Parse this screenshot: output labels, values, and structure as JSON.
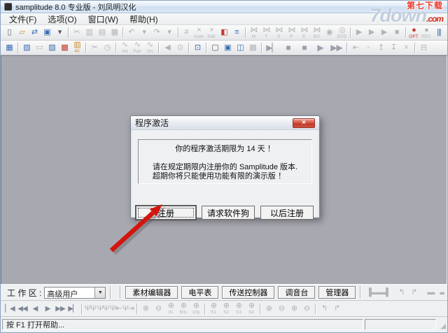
{
  "window": {
    "title": "samplitude 8.0 专业版 - 刘凤明汉化"
  },
  "watermark": {
    "line1": "第七下载",
    "brand": "7down",
    "tld": ".com"
  },
  "menu": {
    "items": [
      {
        "n": "menu-file",
        "label": "文件(F)"
      },
      {
        "n": "menu-options",
        "label": "选项(O)"
      },
      {
        "n": "menu-window",
        "label": "窗口(W)"
      },
      {
        "n": "menu-help",
        "label": "帮助(H)"
      }
    ]
  },
  "toolbar1": {
    "items": [
      {
        "n": "new-project-icon",
        "g": "▯",
        "c": "t",
        "i": "true"
      },
      {
        "n": "open-project-icon",
        "g": "▱",
        "c": "t org",
        "i": "true"
      },
      {
        "n": "import-audio-icon",
        "g": "⇄",
        "c": "t blue",
        "i": "true"
      },
      {
        "n": "save-icon",
        "g": "▣",
        "c": "t blue",
        "i": "true"
      },
      {
        "n": "save-menu-arrow-icon",
        "g": "▾",
        "c": "t",
        "i": "true"
      },
      {
        "n": "separator",
        "g": "",
        "c": "sep",
        "i": "false"
      },
      {
        "n": "cut-icon",
        "g": "✂",
        "c": "t dis",
        "i": "true"
      },
      {
        "n": "copy-icon",
        "g": "▥",
        "c": "t dis",
        "i": "true"
      },
      {
        "n": "paste-icon",
        "g": "▤",
        "c": "t dis",
        "i": "true"
      },
      {
        "n": "paste-special-icon",
        "g": "▦",
        "c": "t dis",
        "i": "true"
      },
      {
        "n": "separator",
        "g": "",
        "c": "sep",
        "i": "false"
      },
      {
        "n": "undo-icon",
        "g": "↶",
        "c": "t dis",
        "i": "true"
      },
      {
        "n": "undo-menu-arrow-icon",
        "g": "▾",
        "c": "t dis",
        "i": "true"
      },
      {
        "n": "redo-icon",
        "g": "↷",
        "c": "t dis",
        "i": "true"
      },
      {
        "n": "redo-menu-arrow-icon",
        "g": "▾",
        "c": "t dis",
        "i": "true"
      },
      {
        "n": "separator",
        "g": "",
        "c": "sep",
        "i": "false"
      },
      {
        "n": "snap-toggle-icon",
        "g": "#",
        "c": "t dis",
        "i": "true"
      },
      {
        "n": "auto-crossfade-icon",
        "g": "×",
        "l": "Auto",
        "c": "t dis",
        "i": "true"
      },
      {
        "n": "edit-crossfade-icon",
        "g": "×",
        "l": "Edit",
        "c": "t dis",
        "i": "true"
      },
      {
        "n": "object-editor-icon",
        "g": "◧",
        "c": "t red",
        "i": "true"
      },
      {
        "n": "track-editor-icon",
        "g": "≡",
        "c": "t blue",
        "i": "true"
      },
      {
        "n": "separator",
        "g": "",
        "c": "sep",
        "i": "false"
      },
      {
        "n": "crossfade-m-icon",
        "g": "⋈",
        "l": "M",
        "c": "t dis",
        "i": "true"
      },
      {
        "n": "crossfade-t-icon",
        "g": "⋈",
        "l": "T",
        "c": "t dis",
        "i": "true"
      },
      {
        "n": "crossfade-s-icon",
        "g": "⋈",
        "l": "S",
        "c": "t dis",
        "i": "true"
      },
      {
        "n": "crossfade-p-icon",
        "g": "⋈",
        "l": "P",
        "c": "t dis",
        "i": "true"
      },
      {
        "n": "crossfade-e-icon",
        "g": "⋈",
        "l": "E",
        "c": "t dis",
        "i": "true"
      },
      {
        "n": "crossfade-62-icon",
        "g": "⋈",
        "l": "6/2",
        "c": "t dis",
        "i": "true"
      },
      {
        "n": "cd-burn-icon",
        "g": "◉",
        "c": "t dis",
        "i": "true"
      },
      {
        "n": "dvd-export-icon",
        "g": "◎",
        "l": "DVD",
        "c": "t dis",
        "i": "true"
      },
      {
        "n": "separator",
        "g": "",
        "c": "sep",
        "i": "false"
      },
      {
        "n": "play-once-icon",
        "g": "▶",
        "c": "t dis",
        "i": "true"
      },
      {
        "n": "play-loop-icon",
        "g": "▶",
        "c": "t dis",
        "i": "true"
      },
      {
        "n": "play-range-icon",
        "g": "▶",
        "c": "t dis",
        "i": "true"
      },
      {
        "n": "stop-playback-icon",
        "g": "■",
        "c": "t dis",
        "i": "true"
      },
      {
        "n": "separator",
        "g": "",
        "c": "sep",
        "i": "false"
      },
      {
        "n": "record-options-icon",
        "g": "●",
        "l": "OPT",
        "c": "t red",
        "i": "true"
      },
      {
        "n": "record-icon",
        "g": "●",
        "l": "REC",
        "c": "t dis",
        "i": "true"
      },
      {
        "n": "mixer-window-icon",
        "g": "|||",
        "c": "t blue",
        "i": "true"
      }
    ]
  },
  "toolbar2": {
    "items": [
      {
        "n": "mouse-mode-universal-icon",
        "g": "▦",
        "c": "t blue",
        "i": "true"
      },
      {
        "n": "separator",
        "g": "",
        "c": "sep",
        "i": "false"
      },
      {
        "n": "mouse-mode-range-icon",
        "g": "▧",
        "c": "t blue",
        "i": "true"
      },
      {
        "n": "mouse-mode-object-icon",
        "g": "▭",
        "c": "t dis",
        "i": "true"
      },
      {
        "n": "mouse-mode-curve-icon",
        "g": "▨",
        "c": "t blue",
        "i": "true"
      },
      {
        "n": "mouse-mode-cut-icon",
        "g": "▩",
        "c": "t red",
        "i": "true"
      },
      {
        "n": "mouse-mode-zoom-icon",
        "g": "▥",
        "l": "40",
        "c": "t org",
        "i": "true"
      },
      {
        "n": "separator",
        "g": "",
        "c": "sep",
        "i": "false"
      },
      {
        "n": "cut-object-icon",
        "g": "✂",
        "c": "t dis",
        "i": "true"
      },
      {
        "n": "time-display-icon",
        "g": "◷",
        "c": "t dis",
        "i": "true"
      },
      {
        "n": "separator",
        "g": "",
        "c": "sep",
        "i": "false"
      },
      {
        "n": "volume-curve-icon",
        "g": "∿",
        "l": "Vol",
        "c": "t dis",
        "i": "true"
      },
      {
        "n": "pan-curve-icon",
        "g": "∿",
        "l": "Pan",
        "c": "t dis",
        "i": "true"
      },
      {
        "n": "wave-curve-icon",
        "g": "∿",
        "l": "Vn",
        "c": "t dis",
        "i": "true"
      },
      {
        "n": "separator",
        "g": "",
        "c": "sep",
        "i": "false"
      },
      {
        "n": "speaker-icon",
        "g": "◀",
        "c": "t dis",
        "i": "true"
      },
      {
        "n": "scrub-magnifier-icon",
        "g": "⊙",
        "c": "t dis",
        "i": "true"
      },
      {
        "n": "separator",
        "g": "",
        "c": "sep",
        "i": "false"
      },
      {
        "n": "monitor-lock-icon",
        "g": "⊡",
        "c": "t blue",
        "i": "true"
      },
      {
        "n": "separator",
        "g": "",
        "c": "sep",
        "i": "false"
      },
      {
        "n": "video-window-icon",
        "g": "▢",
        "c": "t",
        "i": "true"
      },
      {
        "n": "visualization-icon",
        "g": "▣",
        "c": "t blue",
        "i": "true"
      },
      {
        "n": "dual-monitor-icon",
        "g": "◫",
        "c": "t blue",
        "i": "true"
      },
      {
        "n": "grid-view-icon",
        "g": "▩",
        "c": "t dis",
        "i": "true"
      },
      {
        "n": "separator",
        "g": "",
        "c": "sep",
        "i": "false"
      },
      {
        "n": "play-to-start-icon",
        "g": "▶▏",
        "c": "t big",
        "i": "true"
      },
      {
        "n": "stop-icon",
        "g": "■",
        "c": "t big",
        "i": "true"
      },
      {
        "n": "stop-at-position-icon",
        "g": "■",
        "c": "t big",
        "i": "true"
      },
      {
        "n": "play-icon",
        "g": "▶",
        "c": "t big",
        "i": "true"
      },
      {
        "n": "fast-forward-icon",
        "g": "▶▶",
        "c": "t big",
        "i": "true"
      },
      {
        "n": "separator",
        "g": "",
        "c": "sep",
        "i": "false"
      },
      {
        "n": "marker-set-icon",
        "g": "⇤",
        "c": "t dis",
        "i": "true"
      },
      {
        "n": "marker-record-icon",
        "g": "◦",
        "c": "t dis",
        "i": "true"
      },
      {
        "n": "marker-up-icon",
        "g": "↥",
        "c": "t dis",
        "i": "true"
      },
      {
        "n": "marker-down-icon",
        "g": "↧",
        "c": "t dis",
        "i": "true"
      },
      {
        "n": "marker-delete-icon",
        "g": "×",
        "c": "t dis",
        "i": "true"
      },
      {
        "n": "separator",
        "g": "",
        "c": "sep",
        "i": "false"
      },
      {
        "n": "object-group-icon",
        "g": "⊟",
        "c": "t dis",
        "i": "true"
      }
    ]
  },
  "dialog": {
    "title": "程序激活",
    "close_glyph": "×",
    "message_line1": "你的程序激活期限为 14 天 ！",
    "message_line2": "请在规定期限内注册你的 Samplitude 版本.",
    "message_line3": "超期你将只能使用功能有限的演示版 ！",
    "buttons": [
      {
        "label": "注册"
      },
      {
        "label": "请求软件狗"
      },
      {
        "label": "以后注册"
      }
    ]
  },
  "workspace_bar": {
    "label": "工 作 区 :",
    "selected": "高级用户",
    "combo_arrow": "▼",
    "buttons": [
      {
        "n": "material-editor-button",
        "label": "素材编辑器"
      },
      {
        "n": "level-meter-button",
        "label": "电平表"
      },
      {
        "n": "transport-control-button",
        "label": "传送控制器"
      },
      {
        "n": "mixer-button",
        "label": "调音台"
      },
      {
        "n": "manager-button",
        "label": "管理器"
      }
    ],
    "right_icons": [
      {
        "n": "range-to-start-icon",
        "g": "▐▬",
        "c": "t dis",
        "i": "true"
      },
      {
        "n": "range-to-end-icon",
        "g": "▬▌",
        "c": "t dis",
        "i": "true"
      },
      {
        "n": "separator",
        "g": "",
        "c": "sep",
        "i": "false"
      },
      {
        "n": "fold-left-icon",
        "g": "↰",
        "c": "t dis",
        "i": "true"
      },
      {
        "n": "fold-right-icon",
        "g": "↱",
        "c": "t dis",
        "i": "true"
      },
      {
        "n": "separator",
        "g": "",
        "c": "sep",
        "i": "false"
      },
      {
        "n": "range-block-1-icon",
        "g": "▬",
        "c": "t dis",
        "i": "true"
      },
      {
        "n": "range-block-2-icon",
        "g": "▬",
        "c": "t dis",
        "i": "true"
      },
      {
        "n": "range-block-3-icon",
        "g": "▬",
        "c": "t dis",
        "i": "true"
      }
    ]
  },
  "bottombar": {
    "items": [
      {
        "n": "goto-start-icon",
        "g": "▏◀",
        "c": "t nav",
        "i": "true"
      },
      {
        "n": "rewind-fast-icon",
        "g": "◀◀",
        "c": "t nav",
        "i": "true"
      },
      {
        "n": "rewind-icon",
        "g": "◀",
        "c": "t nav",
        "i": "true"
      },
      {
        "n": "forward-icon",
        "g": "▶",
        "c": "t nav",
        "i": "true"
      },
      {
        "n": "forward-fast-icon",
        "g": "▶▶",
        "c": "t nav",
        "i": "true"
      },
      {
        "n": "goto-end-icon",
        "g": "▶▏",
        "c": "t nav",
        "i": "true"
      },
      {
        "n": "separator",
        "g": "",
        "c": "sep",
        "i": "false"
      },
      {
        "n": "wave-view-1-icon",
        "g": "ΨΨ",
        "c": "t dis",
        "i": "true"
      },
      {
        "n": "wave-view-2-icon",
        "g": "ΨΨ",
        "c": "t dis",
        "i": "true"
      },
      {
        "n": "wave-marker-left-icon",
        "g": "Ψ⇤",
        "c": "t dis",
        "i": "true"
      },
      {
        "n": "wave-marker-right-icon",
        "g": "Ψ⇥",
        "c": "t dis",
        "i": "true"
      },
      {
        "n": "separator",
        "g": "",
        "c": "sep",
        "i": "false"
      },
      {
        "n": "zoom-in-icon",
        "g": "⊕",
        "c": "t dis",
        "i": "true"
      },
      {
        "n": "zoom-out-icon",
        "g": "⊖",
        "c": "t dis",
        "i": "true"
      },
      {
        "n": "zoom-0s-icon",
        "g": "⊕",
        "l": "0s",
        "c": "t dis",
        "i": "true"
      },
      {
        "n": "zoom-60s-icon",
        "g": "⊕",
        "l": "60s",
        "c": "t dis",
        "i": "true"
      },
      {
        "n": "zoom-10p-icon",
        "g": "⊕",
        "l": "10p",
        "c": "t dis",
        "i": "true"
      },
      {
        "n": "separator",
        "g": "",
        "c": "sep",
        "i": "false"
      },
      {
        "n": "zoom-snapshot-1-icon",
        "g": "⊕",
        "l": "S1",
        "c": "t dis",
        "i": "true"
      },
      {
        "n": "zoom-snapshot-2-icon",
        "g": "⊕",
        "l": "S2",
        "c": "t dis",
        "i": "true"
      },
      {
        "n": "zoom-snapshot-3-icon",
        "g": "⊕",
        "l": "S3",
        "c": "t dis",
        "i": "true"
      },
      {
        "n": "zoom-snapshot-4-icon",
        "g": "⊕",
        "l": "S4",
        "c": "t dis",
        "i": "true"
      },
      {
        "n": "separator",
        "g": "",
        "c": "sep",
        "i": "false"
      },
      {
        "n": "zoom-object-icon",
        "g": "⊕",
        "c": "t dis",
        "i": "true"
      },
      {
        "n": "zoom-range-icon",
        "g": "⊖",
        "c": "t dis",
        "i": "true"
      },
      {
        "n": "zoom-all-icon",
        "g": "⊕",
        "c": "t dis",
        "i": "true"
      },
      {
        "n": "zoom-previous-icon",
        "g": "⊖",
        "c": "t dis",
        "i": "true"
      },
      {
        "n": "separator",
        "g": "",
        "c": "sep",
        "i": "false"
      },
      {
        "n": "zoom-undo-icon",
        "g": "↰",
        "c": "t dis",
        "i": "true"
      },
      {
        "n": "zoom-redo-icon",
        "g": "↱",
        "c": "t dis",
        "i": "true"
      }
    ]
  },
  "statusbar": {
    "text": "按 F1 打开帮助...",
    "grip": "◢"
  }
}
